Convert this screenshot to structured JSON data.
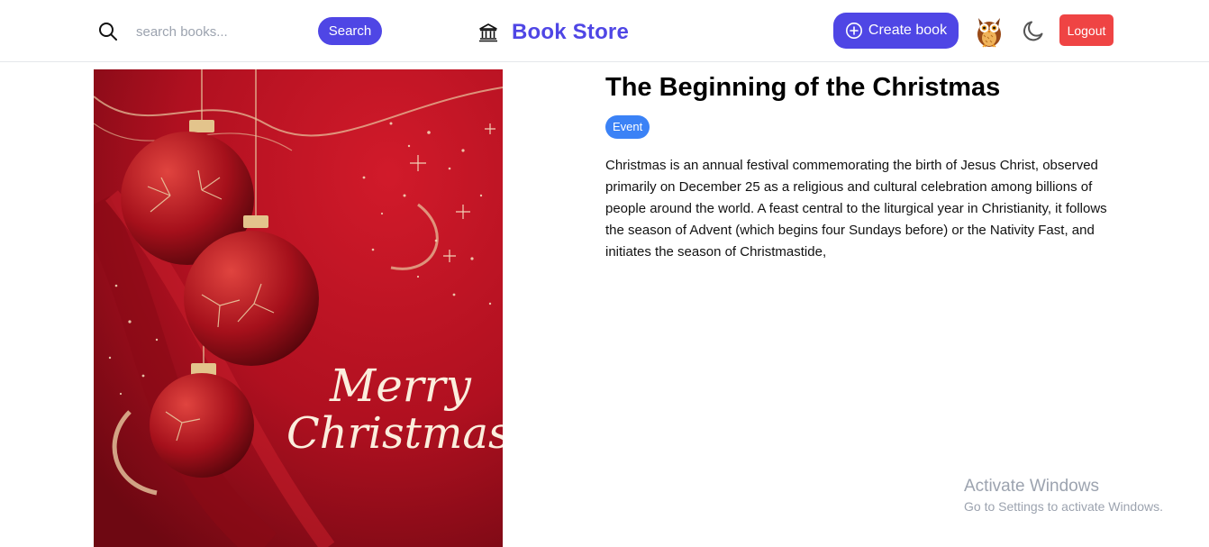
{
  "header": {
    "search": {
      "placeholder": "search books...",
      "value": "",
      "button_label": "Search"
    },
    "brand": {
      "title": "Book Store",
      "icon": "bank-icon"
    },
    "create_button_label": "Create book",
    "avatar_icon": "owl-avatar",
    "theme_icon": "moon-icon",
    "logout_label": "Logout",
    "accent_color": "#4f46e5",
    "logout_color": "#ef4444"
  },
  "book": {
    "title": "The Beginning of the Christmas",
    "category": "Event",
    "category_color": "#3b82f6",
    "description": "Christmas is an annual festival commemorating the birth of Jesus Christ, observed primarily on December 25 as a religious and cultural celebration among billions of people around the world. A feast central to the liturgical year in Christianity, it follows the season of Advent (which begins four Sundays before) or the Nativity Fast, and initiates the season of Christmastide,",
    "cover": {
      "line1": "Merry",
      "line2": "Christmas"
    }
  },
  "watermark": {
    "title": "Activate Windows",
    "subtitle": "Go to Settings to activate Windows."
  }
}
